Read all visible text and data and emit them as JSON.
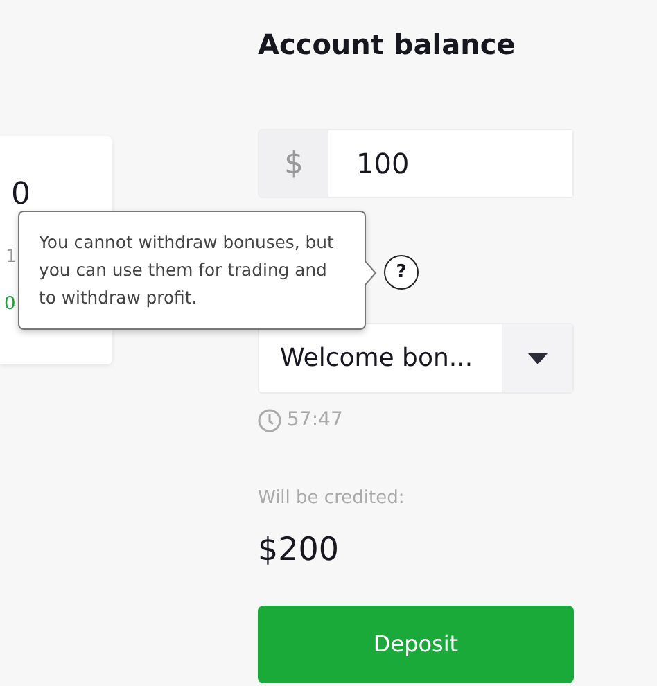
{
  "side_card": {
    "amount": "0",
    "note": "1",
    "profit": "0"
  },
  "title": "Account balance",
  "amount_field": {
    "prefix": "$",
    "value": "100"
  },
  "help": {
    "icon": "?",
    "tooltip": "You cannot withdraw bonuses, but you can use them for trading and to withdraw profit."
  },
  "bonus_select": {
    "value": "Welcome bon..."
  },
  "timer": "57:47",
  "credited_label": "Will be credited:",
  "credited_amount": "$200",
  "deposit_button": "Deposit"
}
